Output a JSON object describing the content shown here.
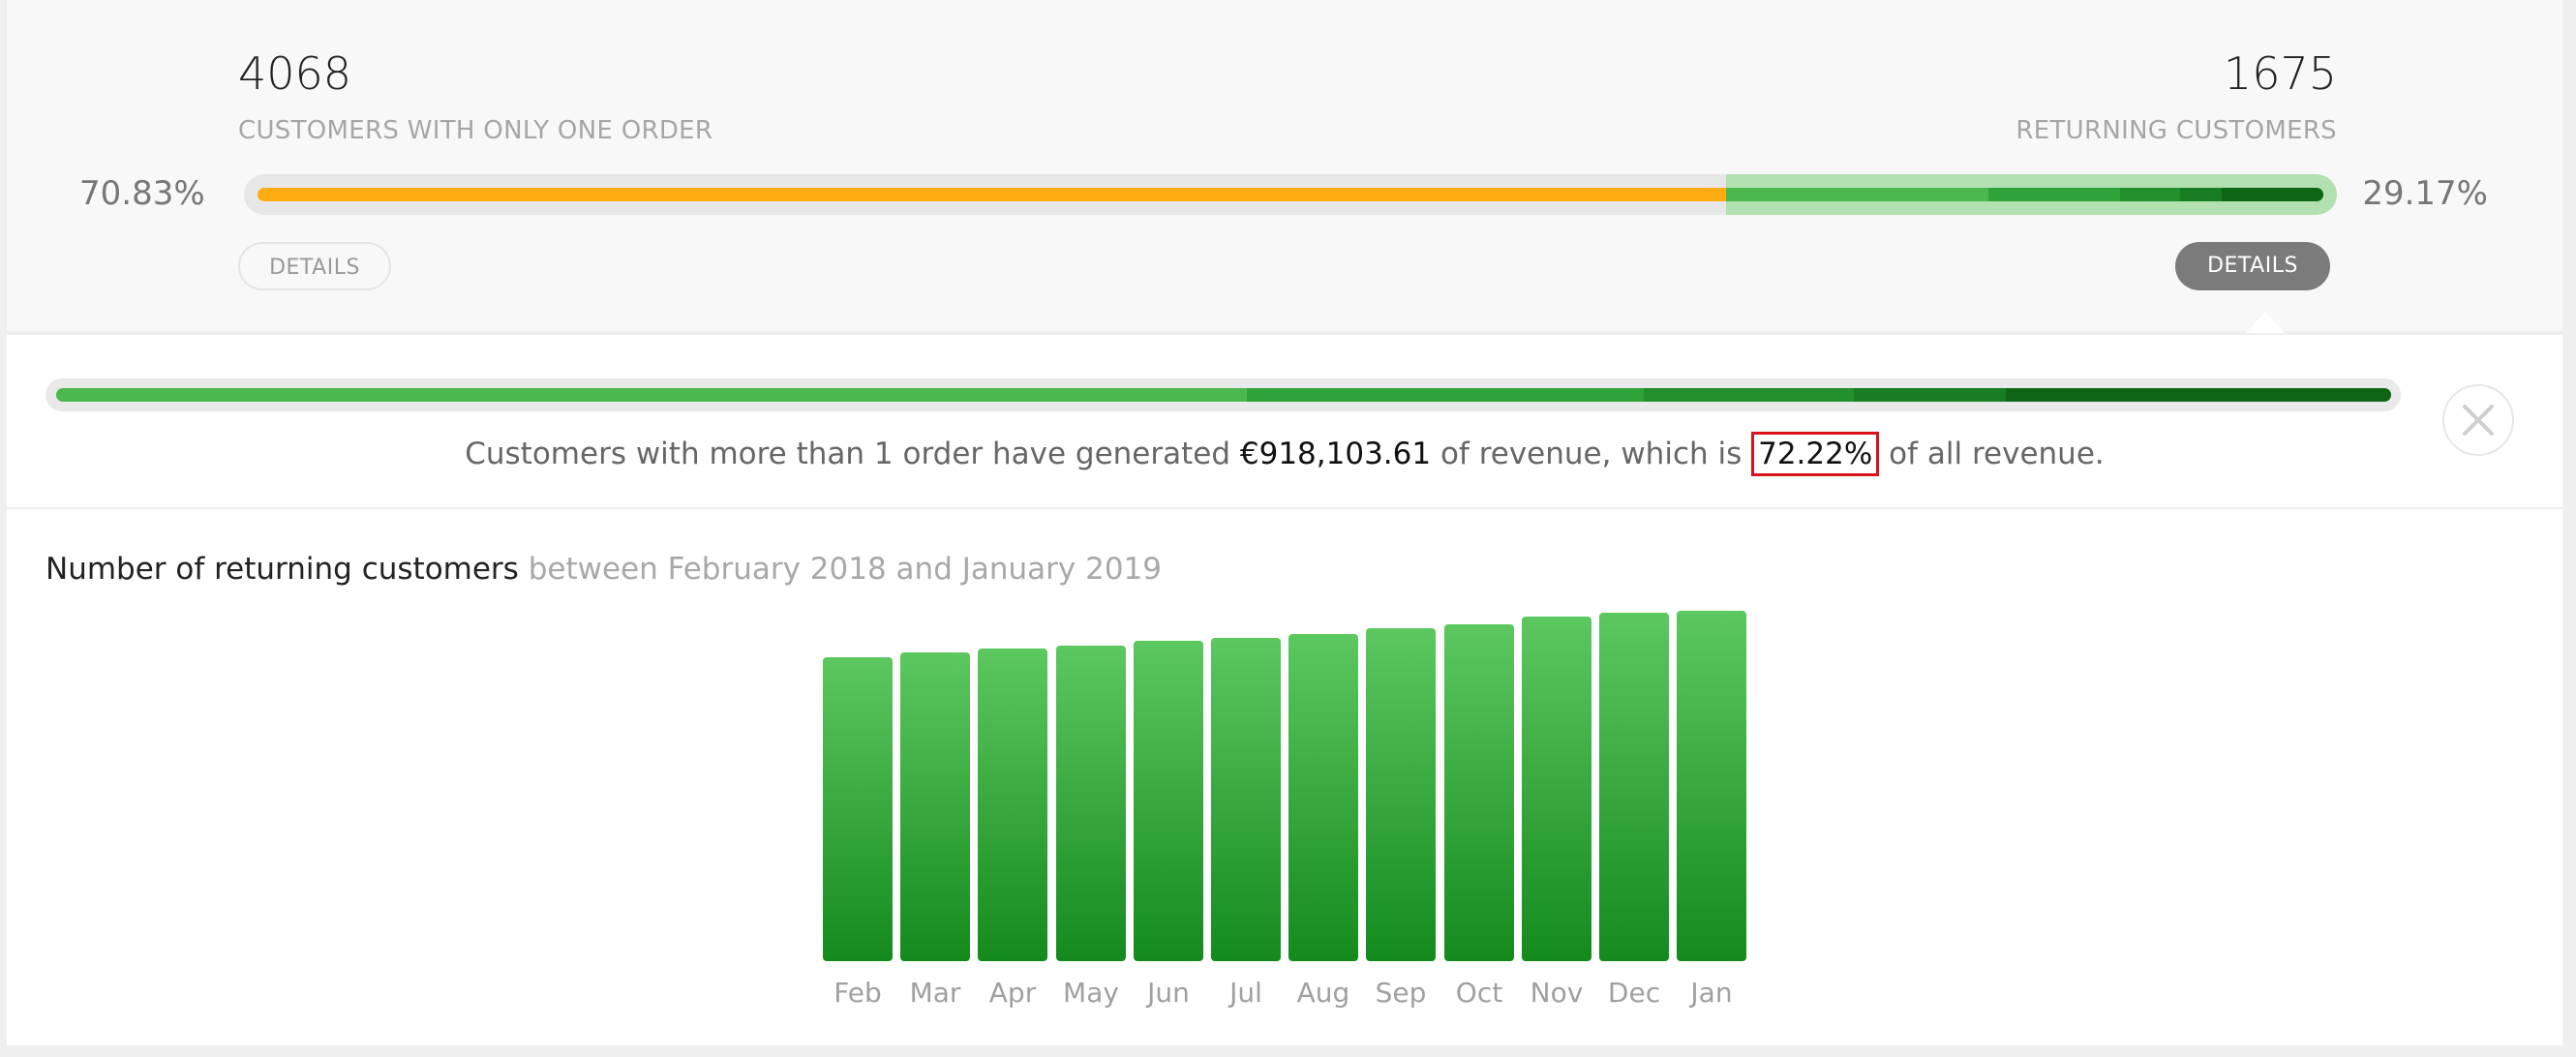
{
  "summary": {
    "one_order": {
      "count": "4068",
      "label": "CUSTOMERS WITH ONLY ONE ORDER",
      "percent": "70.83%",
      "share": 0.7083,
      "details_label": "DETAILS"
    },
    "returning": {
      "count": "1675",
      "label": "RETURNING CUSTOMERS",
      "percent": "29.17%",
      "share": 0.2917,
      "details_label": "DETAILS",
      "breakdown_shades": [
        0.44,
        0.22,
        0.1,
        0.07,
        0.17
      ]
    },
    "colors": {
      "one_order": "#ffac12",
      "returning_shades": [
        "#4bb84e",
        "#2ea33a",
        "#218f2c",
        "#187d22",
        "#0d6515"
      ]
    }
  },
  "details_panel": {
    "revenue_text_before": "Customers with more than 1 order have generated ",
    "revenue_amount": "€918,103.61",
    "revenue_text_middle": " of revenue, which is ",
    "revenue_share": "72.22%",
    "revenue_text_after": " of all revenue.",
    "revenue_breakdown": [
      0.51,
      0.17,
      0.09,
      0.065,
      0.165
    ],
    "close_icon": "close-icon"
  },
  "chart_data": {
    "type": "bar",
    "title": "Number of returning customers",
    "subtitle": "between February 2018 and January 2019",
    "categories": [
      "Feb",
      "Mar",
      "Apr",
      "May",
      "Jun",
      "Jul",
      "Aug",
      "Sep",
      "Oct",
      "Nov",
      "Dec",
      "Jan"
    ],
    "values": [
      1452,
      1475,
      1495,
      1510,
      1530,
      1545,
      1565,
      1590,
      1612,
      1648,
      1665,
      1675
    ],
    "xlabel": "",
    "ylabel": "",
    "ylim": [
      0,
      1675
    ],
    "grid": false,
    "colors": {
      "top": "#5cc85f",
      "bottom": "#148a1d"
    }
  }
}
